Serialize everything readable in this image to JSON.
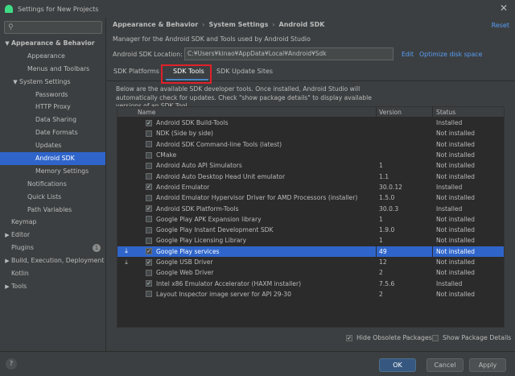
{
  "window": {
    "title": "Settings for New Projects"
  },
  "sidebar": {
    "search_placeholder": "",
    "items": [
      {
        "label": "Appearance & Behavior",
        "arrow": "▼",
        "indent": 0,
        "bold": true
      },
      {
        "label": "Appearance",
        "arrow": "",
        "indent": 2
      },
      {
        "label": "Menus and Toolbars",
        "arrow": "",
        "indent": 2
      },
      {
        "label": "System Settings",
        "arrow": "▼",
        "indent": 1
      },
      {
        "label": "Passwords",
        "arrow": "",
        "indent": 3
      },
      {
        "label": "HTTP Proxy",
        "arrow": "",
        "indent": 3
      },
      {
        "label": "Data Sharing",
        "arrow": "",
        "indent": 3
      },
      {
        "label": "Date Formats",
        "arrow": "",
        "indent": 3
      },
      {
        "label": "Updates",
        "arrow": "",
        "indent": 3
      },
      {
        "label": "Android SDK",
        "arrow": "",
        "indent": 3,
        "selected": true
      },
      {
        "label": "Memory Settings",
        "arrow": "",
        "indent": 3
      },
      {
        "label": "Notifications",
        "arrow": "",
        "indent": 2
      },
      {
        "label": "Quick Lists",
        "arrow": "",
        "indent": 2
      },
      {
        "label": "Path Variables",
        "arrow": "",
        "indent": 2
      },
      {
        "label": "Keymap",
        "arrow": "",
        "indent": 0
      },
      {
        "label": "Editor",
        "arrow": "▶",
        "indent": 0
      },
      {
        "label": "Plugins",
        "arrow": "",
        "indent": 0,
        "badge": "1"
      },
      {
        "label": "Build, Execution, Deployment",
        "arrow": "▶",
        "indent": 0
      },
      {
        "label": "Kotlin",
        "arrow": "",
        "indent": 0
      },
      {
        "label": "Tools",
        "arrow": "▶",
        "indent": 0
      }
    ]
  },
  "header": {
    "breadcrumb": [
      "Appearance & Behavior",
      "System Settings",
      "Android SDK"
    ],
    "reset_label": "Reset",
    "description": "Manager for the Android SDK and Tools used by Android Studio",
    "location_label": "Android SDK Location:",
    "location_value": "C:¥Users¥kinao¥AppData¥Local¥Android¥Sdk",
    "edit_label": "Edit",
    "optimize_label": "Optimize disk space"
  },
  "tabs": [
    "SDK Platforms",
    "SDK Tools",
    "SDK Update Sites"
  ],
  "info_text": "Below are the available SDK developer tools. Once installed, Android Studio will automatically check for updates. Check \"show package details\" to display available versions of an SDK Tool.",
  "table": {
    "columns": [
      "Name",
      "Version",
      "Status"
    ],
    "rows": [
      {
        "name": "Android SDK Build-Tools",
        "version": "",
        "status": "Installed",
        "checked": true,
        "download": false
      },
      {
        "name": "NDK (Side by side)",
        "version": "",
        "status": "Not installed",
        "checked": false,
        "download": false
      },
      {
        "name": "Android SDK Command-line Tools (latest)",
        "version": "",
        "status": "Not installed",
        "checked": false,
        "download": false
      },
      {
        "name": "CMake",
        "version": "",
        "status": "Not installed",
        "checked": false,
        "download": false
      },
      {
        "name": "Android Auto API Simulators",
        "version": "1",
        "status": "Not installed",
        "checked": false,
        "download": false
      },
      {
        "name": "Android Auto Desktop Head Unit emulator",
        "version": "1.1",
        "status": "Not installed",
        "checked": false,
        "download": false
      },
      {
        "name": "Android Emulator",
        "version": "30.0.12",
        "status": "Installed",
        "checked": true,
        "download": false
      },
      {
        "name": "Android Emulator Hypervisor Driver for AMD Processors (installer)",
        "version": "1.5.0",
        "status": "Not installed",
        "checked": false,
        "download": false
      },
      {
        "name": "Android SDK Platform-Tools",
        "version": "30.0.3",
        "status": "Installed",
        "checked": true,
        "download": false
      },
      {
        "name": "Google Play APK Expansion library",
        "version": "1",
        "status": "Not installed",
        "checked": false,
        "download": false
      },
      {
        "name": "Google Play Instant Development SDK",
        "version": "1.9.0",
        "status": "Not installed",
        "checked": false,
        "download": false
      },
      {
        "name": "Google Play Licensing Library",
        "version": "1",
        "status": "Not installed",
        "checked": false,
        "download": false
      },
      {
        "name": "Google Play services",
        "version": "49",
        "status": "Not installed",
        "checked": true,
        "download": true,
        "selected": true
      },
      {
        "name": "Google USB Driver",
        "version": "12",
        "status": "Not installed",
        "checked": true,
        "download": true
      },
      {
        "name": "Google Web Driver",
        "version": "2",
        "status": "Not installed",
        "checked": false,
        "download": false
      },
      {
        "name": "Intel x86 Emulator Accelerator (HAXM installer)",
        "version": "7.5.6",
        "status": "Installed",
        "checked": true,
        "download": false
      },
      {
        "name": "Layout Inspector image server for API 29-30",
        "version": "2",
        "status": "Not installed",
        "checked": false,
        "download": false
      }
    ]
  },
  "options": {
    "hide_obsolete": "Hide Obsolete Packages",
    "show_details": "Show Package Details"
  },
  "buttons": {
    "help": "?",
    "ok": "OK",
    "cancel": "Cancel",
    "apply": "Apply"
  },
  "colors": {
    "selection": "#2f65ca",
    "link": "#589df6",
    "highlight_box": "#e0202a"
  }
}
